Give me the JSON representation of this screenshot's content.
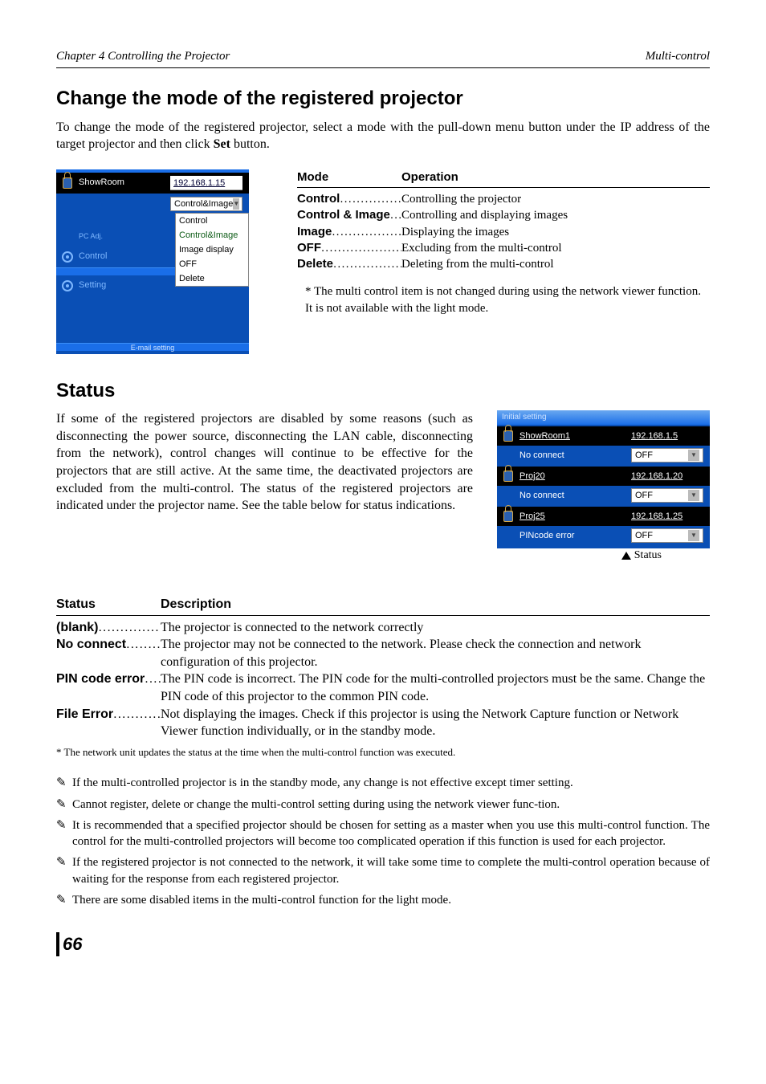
{
  "header": {
    "chapter": "Chapter 4 Controlling the Projector",
    "section": "Multi-control"
  },
  "s1": {
    "title": "Change the mode of the registered projector",
    "intro_a": "To change the mode of the registered projector, select a mode with the pull-down menu button under the IP address of the target projector and then click ",
    "intro_set": "Set",
    "intro_b": " button."
  },
  "ss1": {
    "name": "ShowRoom",
    "ip": "192.168.1.15",
    "selected": "Control&Image",
    "options": [
      "Control",
      "Control&Image",
      "Image display",
      "OFF",
      "Delete"
    ],
    "nav1": "PC Adj.",
    "nav2": "Control",
    "nav3": "Setting",
    "footer": "E-mail setting"
  },
  "mode_table": {
    "h1": "Mode",
    "h2": "Operation",
    "rows": [
      {
        "mode": "Control",
        "op": "Controlling the projector"
      },
      {
        "mode": "Control & Image",
        "op": "Controlling and displaying images"
      },
      {
        "mode": "Image",
        "op": "Displaying the images"
      },
      {
        "mode": "OFF",
        "op": "Excluding from the multi-control"
      },
      {
        "mode": "Delete",
        "op": "Deleting from the multi-control"
      }
    ],
    "note": "* The multi control item is not changed during using the network viewer function. It is not available with the light mode."
  },
  "s2": {
    "title": "Status",
    "para": "If some of the registered projectors are disabled by some reasons (such as disconnecting the power source, disconnecting the LAN cable, disconnecting from the network), control changes will continue to be effective for the projectors that are still active. At the same time, the deactivated projectors are excluded from the multi-control. The status of the registered projectors are indicated under the projector name. See the table below for status indications."
  },
  "ss2": {
    "topbar": "Initial setting",
    "rows": [
      {
        "name": "ShowRoom1",
        "ip": "192.168.1.5",
        "status": "No connect",
        "dd": "OFF"
      },
      {
        "name": "Proj20",
        "ip": "192.168.1.20",
        "status": "No connect",
        "dd": "OFF"
      },
      {
        "name": "Proj25",
        "ip": "192.168.1.25",
        "status": "PINcode error",
        "dd": "OFF"
      }
    ],
    "callout": "Status"
  },
  "status_table": {
    "h1": "Status",
    "h2": "Description",
    "rows": [
      {
        "s": "(blank)",
        "d": "The projector is connected to the network correctly"
      },
      {
        "s": "No connect",
        "d": "The projector may not be connected to the network. Please check the connection and network configuration of this projector."
      },
      {
        "s": "PIN code error",
        "d": "The PIN code is incorrect. The PIN code for the multi-controlled projectors must be the same. Change the PIN code of this projector to the common PIN code."
      },
      {
        "s": "File Error",
        "d": "Not displaying the images. Check if this projector is using the Network Capture function or Network Viewer function individually, or  in the standby mode."
      }
    ],
    "small": "* The network unit updates the status at the time when the multi-control function was executed."
  },
  "notes": [
    "If the multi-controlled projector is in the standby mode, any change is not effective except timer setting.",
    "Cannot register, delete or change the multi-control setting during using the network viewer func-tion.",
    "It is recommended that a specified projector should be chosen for setting as a master when you use this multi-control function. The control for the multi-controlled projectors will become too complicated operation if this function is used for each projector.",
    "If the registered projector is not connected to the network, it will take some time to complete the multi-control operation because of waiting for the response from each registered projector.",
    "There are some disabled items in the multi-control function for the light mode."
  ],
  "page": "66",
  "pencil_glyph": "✎"
}
